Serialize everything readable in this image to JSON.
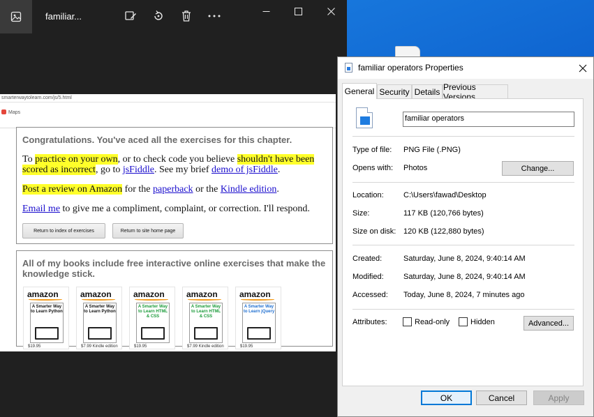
{
  "photos": {
    "title": "familiar...",
    "tools": [
      "edit-image-icon",
      "rotate-icon",
      "delete-icon",
      "more-icon"
    ],
    "image": {
      "url": "smarterwaytolearn.com/js/5.html",
      "bookmark": "Maps",
      "congrats": "Congratulations. You've aced all the exercises for this chapter.",
      "p1": {
        "a": "To ",
        "b": "practice on your own",
        "c": ", or to check code you believe ",
        "d": "shouldn't have been scored as incorrect",
        "e": ", go to ",
        "f": "jsFiddle",
        "g": ". See my brief ",
        "h": "demo of jsFiddle",
        "i": "."
      },
      "p2": {
        "a": "Post a review on Amazon",
        "b": " for the ",
        "c": "paperback",
        "d": " or the ",
        "e": "Kindle edition",
        "f": "."
      },
      "p3": {
        "a": "Email me",
        "b": " to give me a compliment, complaint, or correction. I'll respond."
      },
      "btn_index": "Return to index of exercises",
      "btn_home": "Return to site home page",
      "books_head": "All of my books include free interactive online exercises that make the knowledge stick.",
      "books": [
        {
          "logo": "amazon",
          "title": "A Smarter Way to Learn Python",
          "price": "$19.95",
          "color": "#111111"
        },
        {
          "logo": "amazon",
          "title": "A Smarter Way to Learn Python",
          "price": "$7.99 Kindle edition",
          "color": "#111111"
        },
        {
          "logo": "amazon",
          "title": "A Smarter Way to Learn HTML & CSS",
          "price": "$19.95",
          "color": "#1b9b3a"
        },
        {
          "logo": "amazon",
          "title": "A Smarter Way to Learn HTML & CSS",
          "price": "$7.99 Kindle edition",
          "color": "#1b9b3a"
        },
        {
          "logo": "amazon",
          "title": "A Smarter Way to Learn jQuery",
          "price": "$19.95",
          "color": "#1f6fd0"
        }
      ]
    }
  },
  "dialog": {
    "title": "familiar operators Properties",
    "tabs": [
      "General",
      "Security",
      "Details",
      "Previous Versions"
    ],
    "file_name": "familiar operators",
    "type_label": "Type of file:",
    "type_value": "PNG File (.PNG)",
    "opens_label": "Opens with:",
    "opens_value": "Photos",
    "change_button": "Change...",
    "location_label": "Location:",
    "location_value": "C:\\Users\\fawad\\Desktop",
    "size_label": "Size:",
    "size_value": "117 KB (120,766 bytes)",
    "size_disk_label": "Size on disk:",
    "size_disk_value": "120 KB (122,880 bytes)",
    "created_label": "Created:",
    "created_value": "Saturday, June 8, 2024, 9:40:14 AM",
    "modified_label": "Modified:",
    "modified_value": "Saturday, June 8, 2024, 9:40:14 AM",
    "accessed_label": "Accessed:",
    "accessed_value": "Today, June 8, 2024, 7 minutes ago",
    "attributes_label": "Attributes:",
    "readonly_label": "Read-only",
    "hidden_label": "Hidden",
    "advanced_button": "Advanced...",
    "ok_button": "OK",
    "cancel_button": "Cancel",
    "apply_button": "Apply"
  },
  "colors": {
    "accent": "#0078d7",
    "highlight": "#ffff2a",
    "link": "#1a0dcd"
  }
}
